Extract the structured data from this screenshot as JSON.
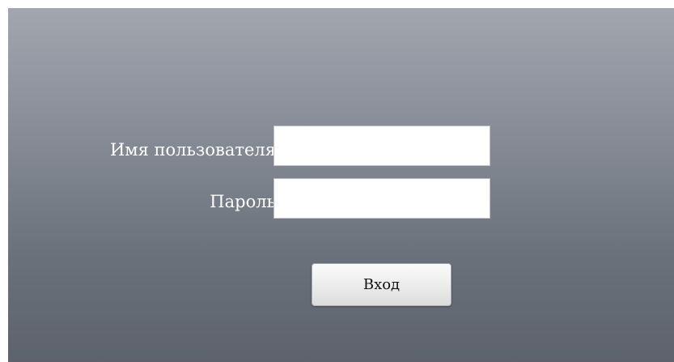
{
  "login_form": {
    "username_label": "Имя пользователя",
    "username_value": "",
    "password_label": "Пароль",
    "password_value": "",
    "submit_label": "Вход"
  },
  "colors": {
    "panel_top": "#a1a6af",
    "panel_bottom": "#5d626c",
    "label_text": "#ffffff",
    "field_background": "#ffffff"
  }
}
